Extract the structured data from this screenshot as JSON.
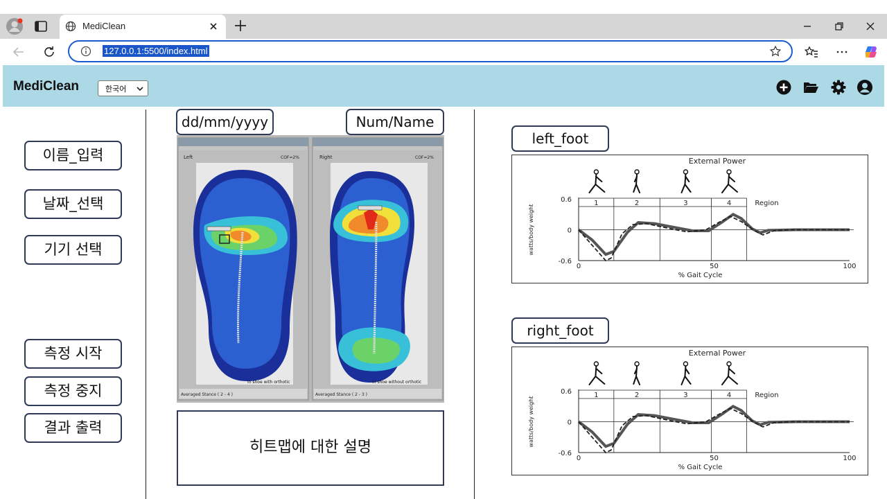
{
  "browser": {
    "tab_title": "MediClean",
    "url": "127.0.0.1:5500/index.html"
  },
  "header": {
    "app_title": "MediClean",
    "language_selected": "한국어",
    "icons": [
      "plus-circle-icon",
      "folder-open-icon",
      "gear-icon",
      "user-circle-icon"
    ]
  },
  "sidebar": {
    "buttons": [
      "이름_입력",
      "날짜_선택",
      "기기 선택",
      "측정 시작",
      "측정 중지",
      "결과 출력"
    ]
  },
  "middle": {
    "date_placeholder": "dd/mm/yyyy",
    "num_name": "Num/Name",
    "description": "히트맵에 대한 설명"
  },
  "heatmap_labels": {
    "left_window": "Left",
    "right_window": "Right",
    "left_cof": "COF=2%",
    "right_cof": "COF=2%",
    "left_footer": "Averaged Stance ( 2 - 4 )",
    "right_footer": "Averaged Stance ( 2 - 3 )",
    "left_caption": "in shoe with orthotic",
    "right_caption": "in shoe without orthotic"
  },
  "right_panel": {
    "left_label": "left_foot",
    "right_label": "right_foot"
  },
  "chart_data": [
    {
      "type": "line",
      "title": "External Power",
      "xlabel": "% Gait Cycle",
      "ylabel": "watts/body weight",
      "xlim": [
        0,
        100
      ],
      "ylim": [
        -0.6,
        0.6
      ],
      "xticks": [
        "0",
        "50",
        "100"
      ],
      "yticks": [
        "0.6",
        "0",
        "-0.6"
      ],
      "regions": [
        "1",
        "2",
        "3",
        "4"
      ],
      "region_label": "Region",
      "region_bounds": [
        0,
        13,
        30,
        49,
        62
      ],
      "series": [
        {
          "values": [
            [
              0,
              0
            ],
            [
              5,
              -0.2
            ],
            [
              10,
              -0.48
            ],
            [
              13,
              -0.42
            ],
            [
              18,
              -0.05
            ],
            [
              22,
              0.14
            ],
            [
              28,
              0.12
            ],
            [
              35,
              0.05
            ],
            [
              42,
              -0.02
            ],
            [
              48,
              -0.02
            ],
            [
              53,
              0.15
            ],
            [
              57,
              0.3
            ],
            [
              60,
              0.22
            ],
            [
              64,
              0.02
            ],
            [
              67,
              -0.06
            ],
            [
              70,
              -0.01
            ],
            [
              80,
              0
            ],
            [
              100,
              0
            ]
          ]
        },
        {
          "values": [
            [
              0,
              0
            ],
            [
              5,
              -0.3
            ],
            [
              10,
              -0.6
            ],
            [
              12,
              -0.55
            ],
            [
              16,
              -0.08
            ],
            [
              20,
              0.1
            ],
            [
              25,
              0.12
            ],
            [
              33,
              0.03
            ],
            [
              40,
              -0.04
            ],
            [
              47,
              0
            ],
            [
              52,
              0.15
            ],
            [
              56,
              0.26
            ],
            [
              60,
              0.16
            ],
            [
              65,
              -0.02
            ],
            [
              68,
              -0.1
            ],
            [
              72,
              -0.02
            ],
            [
              78,
              0
            ],
            [
              100,
              0
            ]
          ]
        }
      ]
    },
    {
      "type": "line",
      "title": "External Power",
      "xlabel": "% Gait Cycle",
      "ylabel": "watts/body weight",
      "xlim": [
        0,
        100
      ],
      "ylim": [
        -0.6,
        0.6
      ],
      "xticks": [
        "0",
        "50",
        "100"
      ],
      "yticks": [
        "0.6",
        "0",
        "-0.6"
      ],
      "regions": [
        "1",
        "2",
        "3",
        "4"
      ],
      "region_label": "Region",
      "region_bounds": [
        0,
        13,
        30,
        49,
        62
      ],
      "series": [
        {
          "values": [
            [
              0,
              0
            ],
            [
              5,
              -0.2
            ],
            [
              10,
              -0.48
            ],
            [
              13,
              -0.42
            ],
            [
              18,
              -0.05
            ],
            [
              22,
              0.14
            ],
            [
              28,
              0.12
            ],
            [
              35,
              0.05
            ],
            [
              42,
              -0.02
            ],
            [
              48,
              -0.02
            ],
            [
              53,
              0.15
            ],
            [
              57,
              0.3
            ],
            [
              60,
              0.22
            ],
            [
              64,
              0.02
            ],
            [
              67,
              -0.06
            ],
            [
              70,
              -0.01
            ],
            [
              80,
              0
            ],
            [
              100,
              0
            ]
          ]
        },
        {
          "values": [
            [
              0,
              0
            ],
            [
              5,
              -0.3
            ],
            [
              10,
              -0.6
            ],
            [
              12,
              -0.55
            ],
            [
              16,
              -0.08
            ],
            [
              20,
              0.1
            ],
            [
              25,
              0.12
            ],
            [
              33,
              0.03
            ],
            [
              40,
              -0.04
            ],
            [
              47,
              0
            ],
            [
              52,
              0.15
            ],
            [
              56,
              0.26
            ],
            [
              60,
              0.16
            ],
            [
              65,
              -0.02
            ],
            [
              68,
              -0.1
            ],
            [
              72,
              -0.02
            ],
            [
              78,
              0
            ],
            [
              100,
              0
            ]
          ]
        }
      ]
    }
  ]
}
